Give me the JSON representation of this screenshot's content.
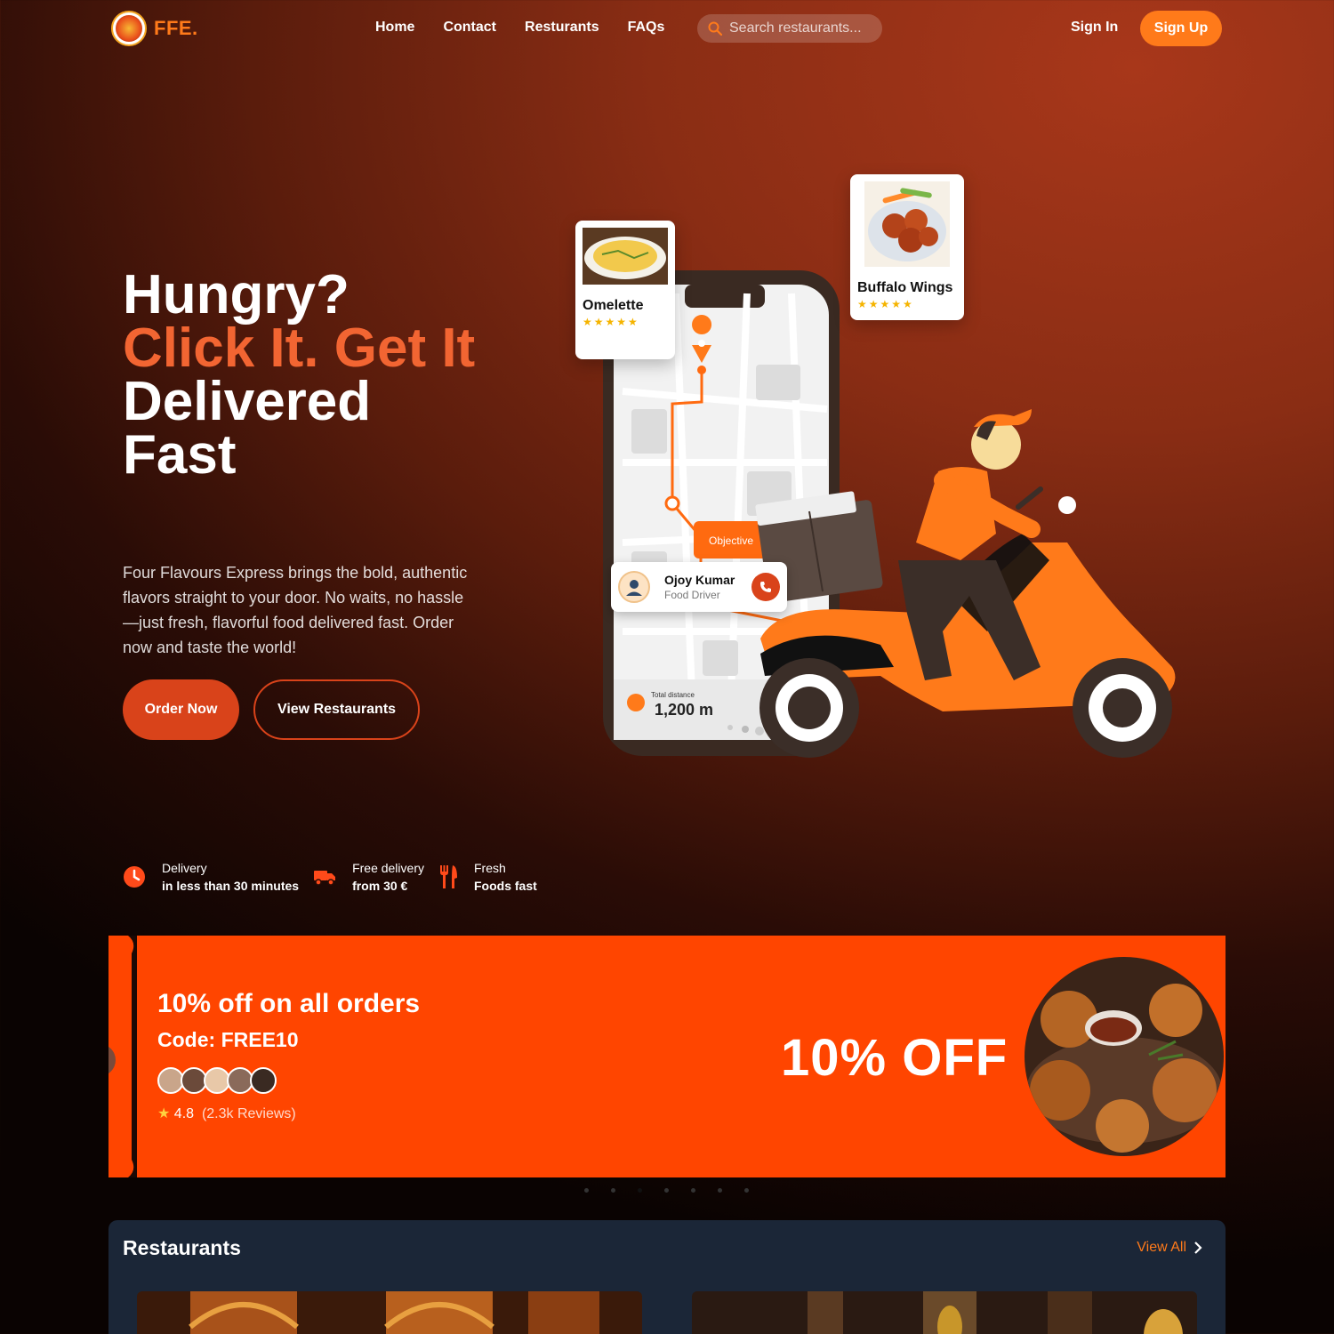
{
  "nav": {
    "logo_text": "FFE.",
    "links": [
      "Home",
      "Contact",
      "Resturants",
      "FAQs"
    ],
    "search_placeholder": "Search restaurants...",
    "sign_in": "Sign In",
    "sign_up": "Sign Up"
  },
  "hero": {
    "line1": "Hungry?",
    "line2": "Click It. Get It",
    "line3": "Delivered Fast",
    "description": "Four Flavours Express brings the bold, authentic flavors straight to your door. No waits, no hassle—just fresh, flavorful food delivered fast. Order now and taste the world!",
    "order_now": "Order Now",
    "view_restaurants": "View Restaurants"
  },
  "illustration": {
    "card1_name": "Omelette",
    "card2_name": "Buffalo Wings",
    "stars": "★★★★★",
    "driver_name": "Ojoy Kumar",
    "driver_role": "Food Driver",
    "map_label": "Objective",
    "distance_label": "Total distance",
    "distance_value": "1,200 m"
  },
  "features": [
    {
      "icon": "clock-icon",
      "t1": "Delivery",
      "t2": "in less than 30 minutes"
    },
    {
      "icon": "truck-icon",
      "t1": "Free delivery",
      "t2": "from 30 €"
    },
    {
      "icon": "utensils-icon",
      "t1": "Fresh",
      "t2": "Foods fast"
    }
  ],
  "promo": {
    "headline": "10% off on all orders",
    "code_label": "Code: ",
    "code": "FREE10",
    "rating": "4.8",
    "reviews": "(2.3k Reviews)",
    "big_text": "10% OFF",
    "accent_color": "#ff4500"
  },
  "carousel": {
    "count": 7,
    "active_index": 2
  },
  "restaurants": {
    "title": "Restaurants",
    "view_all": "View All"
  },
  "colors": {
    "accent": "#ff7a1a",
    "primary_button": "#d9431a",
    "highlight_text": "#f26532",
    "panel": "#1b2637"
  }
}
